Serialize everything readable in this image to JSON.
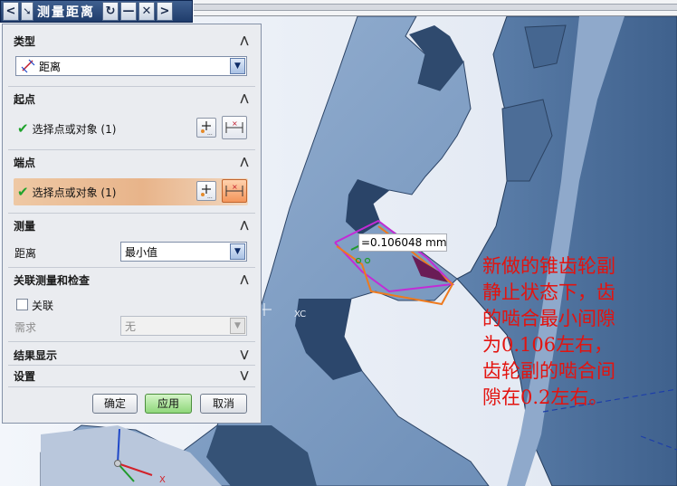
{
  "window": {
    "title": "测量距离",
    "nav_back": "<",
    "nav_forward": ">",
    "reset_glyph": "↻",
    "minimize_glyph": "—",
    "close_glyph": "✕"
  },
  "dialog": {
    "sections": {
      "type": {
        "title": "类型",
        "value": "距离",
        "icon": "distance-icon"
      },
      "start_point": {
        "title": "起点",
        "selection_label": "选择点或对象 (1)"
      },
      "end_point": {
        "title": "端点",
        "selection_label": "选择点或对象 (1)"
      },
      "measure": {
        "title": "测量",
        "field_label": "距离",
        "field_value": "最小值"
      },
      "associative": {
        "title": "关联测量和检查",
        "checkbox_label": "关联",
        "requirement_label": "需求",
        "requirement_value": "无"
      },
      "results": {
        "title": "结果显示"
      },
      "settings": {
        "title": "设置"
      }
    },
    "buttons": {
      "ok": "确定",
      "apply": "应用",
      "cancel": "取消"
    }
  },
  "viewport": {
    "measurement_value": "=0.106048 mm",
    "axis_label": "XC",
    "triad_x_label": "X",
    "annotation_lines": [
      "新做的锥齿轮副",
      "静止状态下，齿",
      "的啮合最小间隙",
      "为0.106左右，",
      "齿轮副的啮合间",
      "隙在0.2左右。"
    ]
  },
  "colors": {
    "gear_face": "#7f9ec4",
    "gear_dark": "#34506f",
    "background": "#e9eef6",
    "annotation_red": "#e3130f",
    "highlight_magenta": "#c32bd6",
    "highlight_orange": "#ee7a1e",
    "check_green": "#1fa32c"
  }
}
